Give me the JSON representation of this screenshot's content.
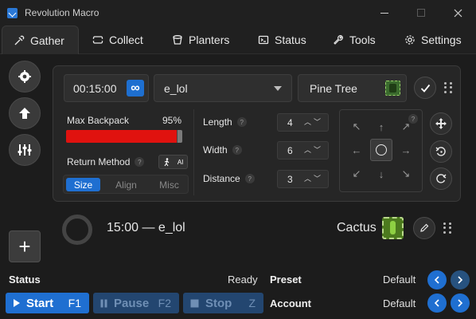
{
  "window": {
    "title": "Revolution Macro"
  },
  "tabs": [
    {
      "label": "Gather",
      "icon": "gather-icon"
    },
    {
      "label": "Collect",
      "icon": "ticket-icon"
    },
    {
      "label": "Planters",
      "icon": "pot-icon"
    },
    {
      "label": "Status",
      "icon": "terminal-icon"
    },
    {
      "label": "Tools",
      "icon": "wrench-icon"
    },
    {
      "label": "Settings",
      "icon": "gear-icon"
    }
  ],
  "gather": {
    "timer": "00:15:00",
    "infinite_symbol": "∞",
    "pattern": "e_lol",
    "field": "Pine Tree",
    "max_backpack_label": "Max Backpack",
    "max_backpack_percent": "95%",
    "max_backpack_value": 95,
    "return_method_label": "Return Method",
    "return_method_icon_text": "AI",
    "shape_options": [
      "Size",
      "Align",
      "Misc"
    ],
    "shape_selected": "Size",
    "params": [
      {
        "label": "Length",
        "value": "4"
      },
      {
        "label": "Width",
        "value": "6"
      },
      {
        "label": "Distance",
        "value": "3"
      }
    ],
    "help_mark": "?"
  },
  "second_row": {
    "text": "15:00 — e_lol",
    "field": "Cactus"
  },
  "bottom": {
    "status_label": "Status",
    "status_value": "Ready",
    "preset_label": "Preset",
    "preset_value": "Default",
    "account_label": "Account",
    "account_value": "Default",
    "start": {
      "label": "Start",
      "key": "F1"
    },
    "pause": {
      "label": "Pause",
      "key": "F2"
    },
    "stop": {
      "label": "Stop",
      "key": "Z"
    },
    "plus": "+"
  },
  "colors": {
    "accent": "#1f6fd1",
    "backpack_fill": "#e0120f",
    "background": "#1c1c1c"
  }
}
